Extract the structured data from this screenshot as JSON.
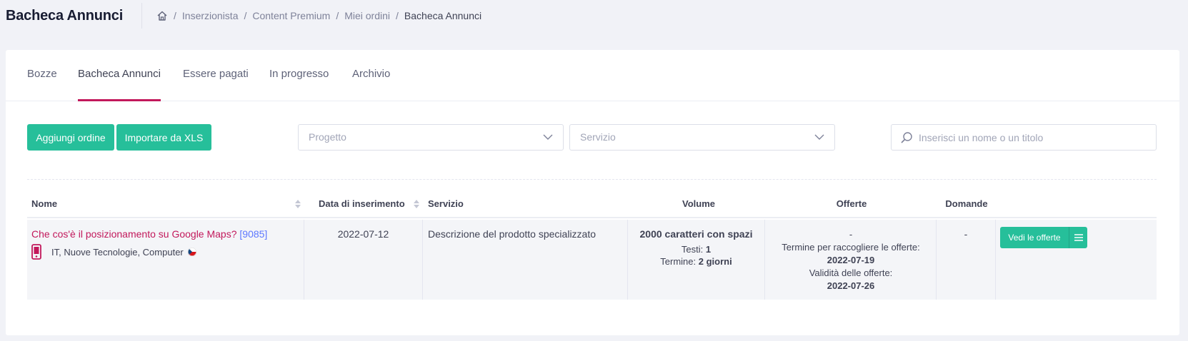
{
  "header": {
    "title": "Bacheca Annunci",
    "breadcrumb": {
      "home_icon": "home-icon",
      "separator": "/",
      "items": [
        "Inserzionista",
        "Content Premium",
        "Miei ordini",
        "Bacheca Annunci"
      ]
    }
  },
  "tabs": [
    {
      "label": "Bozze",
      "active": false
    },
    {
      "label": "Bacheca Annunci",
      "active": true
    },
    {
      "label": "Essere pagati",
      "active": false
    },
    {
      "label": "In progresso",
      "active": false
    },
    {
      "label": "Archivio",
      "active": false
    }
  ],
  "toolbar": {
    "add_order_label": "Aggiungi ordine",
    "import_label": "Importare da XLS",
    "project_select": {
      "placeholder": "Progetto"
    },
    "service_select": {
      "placeholder": "Servizio"
    },
    "search": {
      "placeholder": "Inserisci un nome o un titolo",
      "value": ""
    }
  },
  "table": {
    "columns": {
      "nome": "Nome",
      "data": "Data di inserimento",
      "servizio": "Servizio",
      "volume": "Volume",
      "offerte": "Offerte",
      "domande": "Domande"
    },
    "rows": [
      {
        "title": "Che cos'è il posizionamento su Google Maps?",
        "id": "[9085]",
        "category": "IT, Nuove Tecnologie, Computer",
        "date": "2022-07-12",
        "service": "Descrizione del prodotto specializzato",
        "volume_main": "2000 caratteri con spazi",
        "testi_label": "Testi:",
        "testi_value": "1",
        "termine_label": "Termine:",
        "termine_value": "2 giorni",
        "offers_dash": "-",
        "offers_deadline_label": "Termine per raccogliere le offerte:",
        "offers_deadline_value": "2022-07-19",
        "offers_validity_label": "Validità delle offerte:",
        "offers_validity_value": "2022-07-26",
        "questions": "-",
        "view_offers_label": "Vedi le offerte"
      }
    ]
  },
  "colors": {
    "accent_green": "#26bf9a",
    "accent_pink": "#c2185b",
    "link_blue": "#5d78ff"
  }
}
